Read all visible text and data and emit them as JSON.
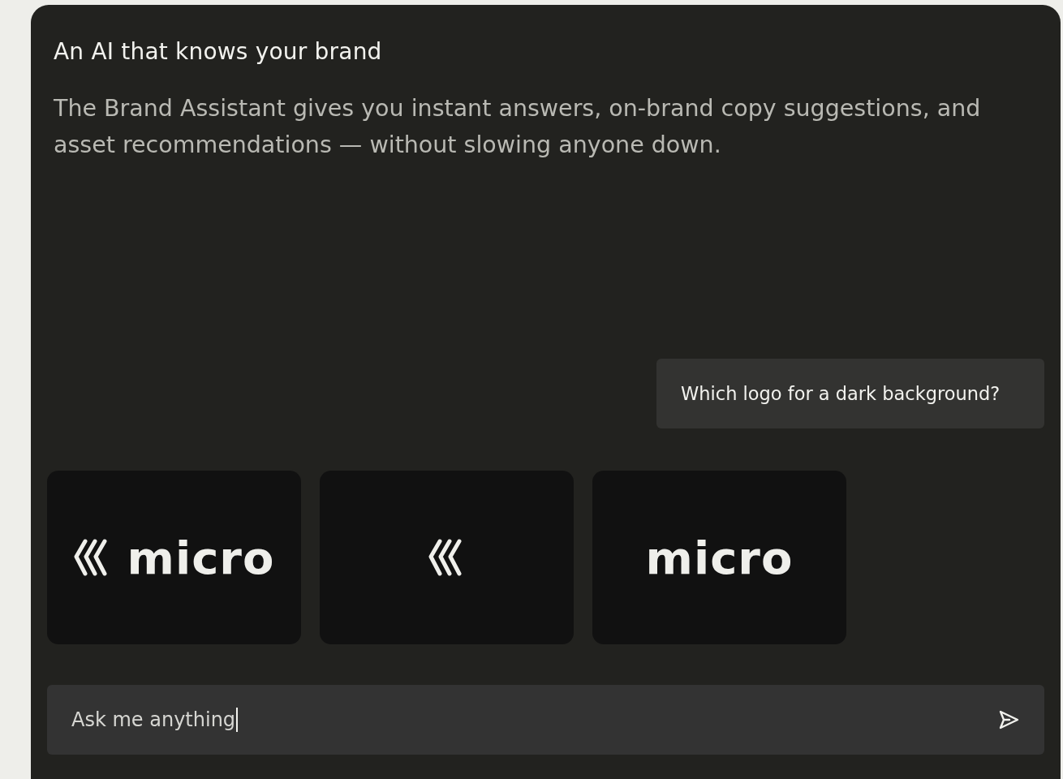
{
  "panel": {
    "title": "An AI that knows your brand",
    "description": "The Brand Assistant gives you instant answers, on-brand copy suggestions, and asset recommendations — without slowing anyone down."
  },
  "chat": {
    "message": "Which logo for a dark background?",
    "logos": [
      {
        "kind": "full",
        "text": "micro"
      },
      {
        "kind": "mark"
      },
      {
        "kind": "wordmark",
        "text": "micro"
      }
    ]
  },
  "composer": {
    "value": "Ask me anything"
  }
}
